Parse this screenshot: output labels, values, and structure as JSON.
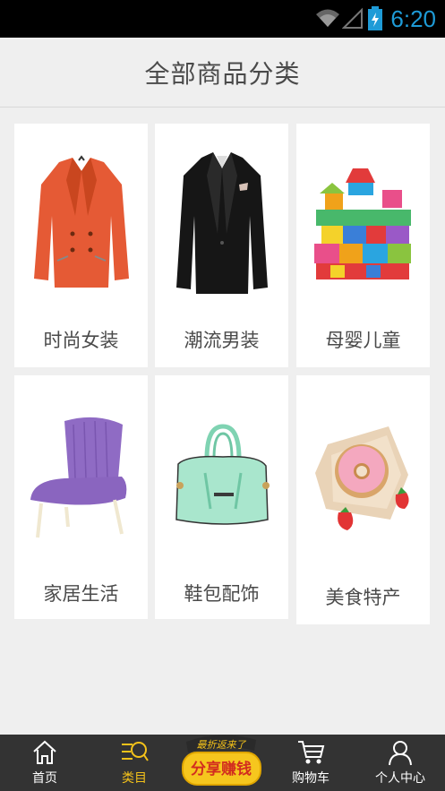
{
  "status_bar": {
    "time": "6:20"
  },
  "header": {
    "title": "全部商品分类"
  },
  "categories": [
    {
      "label": "时尚女装",
      "image": "orange-blazer"
    },
    {
      "label": "潮流男装",
      "image": "black-suit-jacket"
    },
    {
      "label": "母婴儿童",
      "image": "toy-blocks"
    },
    {
      "label": "家居生活",
      "image": "purple-chair"
    },
    {
      "label": "鞋包配饰",
      "image": "mint-handbag"
    },
    {
      "label": "美食特产",
      "image": "donut"
    }
  ],
  "tabs": [
    {
      "label": "首页",
      "icon": "home-icon",
      "active": false
    },
    {
      "label": "类目",
      "icon": "category-search-icon",
      "active": true
    },
    {
      "label": "购物车",
      "icon": "cart-icon",
      "active": false
    },
    {
      "label": "个人中心",
      "icon": "user-icon",
      "active": false
    }
  ],
  "promo": {
    "top_text": "最折返来了",
    "main_text": "分享赚钱"
  },
  "colors": {
    "active_tab": "#f4c21a",
    "tab_bar": "#333333",
    "status_time": "#1e9bd7"
  }
}
